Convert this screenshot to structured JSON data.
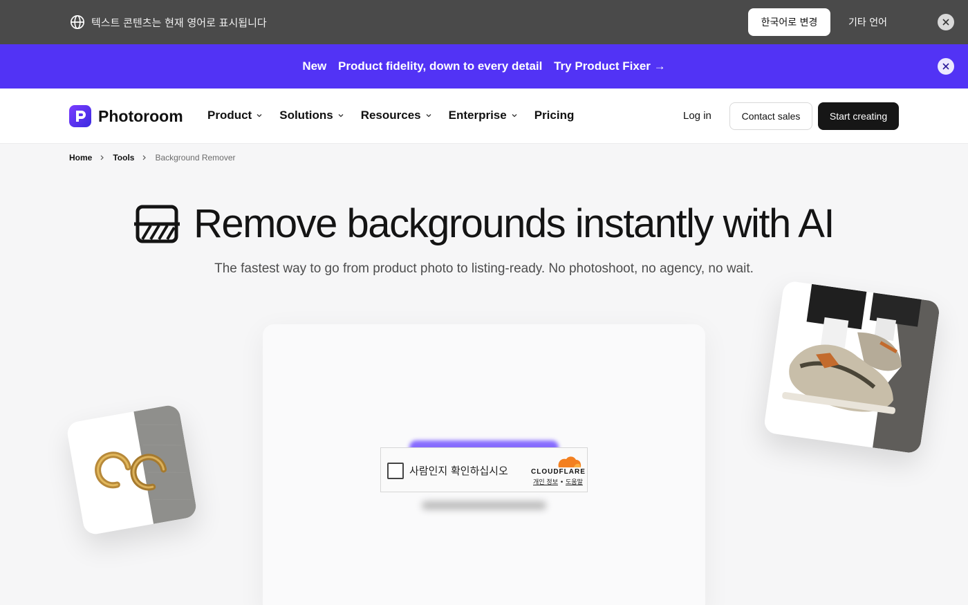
{
  "language_bar": {
    "message": "텍스트 콘텐츠는 현재 영어로 표시됩니다",
    "switch_label": "한국어로 변경",
    "other_label": "기타 언어"
  },
  "promo": {
    "badge": "New",
    "text": "Product fidelity, down to every detail",
    "cta": "Try Product Fixer →"
  },
  "nav": {
    "logo": "Photoroom",
    "items": [
      {
        "label": "Product",
        "dropdown": true
      },
      {
        "label": "Solutions",
        "dropdown": true
      },
      {
        "label": "Resources",
        "dropdown": true
      },
      {
        "label": "Enterprise",
        "dropdown": true
      },
      {
        "label": "Pricing",
        "dropdown": false
      }
    ],
    "login": "Log in",
    "contact": "Contact sales",
    "start": "Start creating"
  },
  "breadcrumb": [
    "Home",
    "Tools",
    "Background Remover"
  ],
  "hero": {
    "title": "Remove backgrounds instantly with AI",
    "subtitle": "The fastest way to go from product photo to listing-ready. No photoshoot, no agency, no wait."
  },
  "captcha": {
    "label": "사람인지 확인하십시오",
    "brand": "CLOUDFLARE",
    "privacy": "개인 정보",
    "help": "도움말"
  },
  "colors": {
    "promo_bg": "#5233f5",
    "lang_bar_bg": "#4a4a4a",
    "start_btn": "#161616",
    "cloudflare": "#f38020"
  }
}
